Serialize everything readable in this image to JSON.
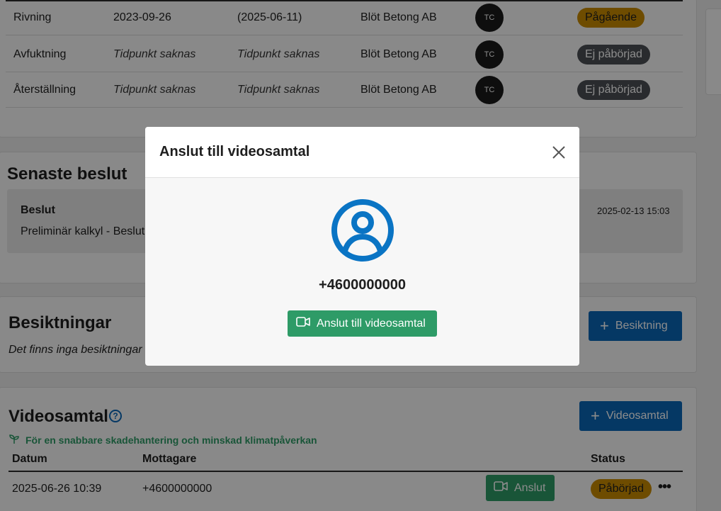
{
  "phases": [
    {
      "name": "Rivning",
      "start": "2023-09-26",
      "end": "(2025-06-11)",
      "company": "Blöt Betong AB",
      "avatar": "TC",
      "status": "Pågående",
      "status_color": "orange"
    },
    {
      "name": "Avfuktning",
      "start": "Tidpunkt saknas",
      "end": "Tidpunkt saknas",
      "company": "Blöt Betong AB",
      "avatar": "TC",
      "status": "Ej påbörjad",
      "status_color": "gray"
    },
    {
      "name": "Återställning",
      "start": "Tidpunkt saknas",
      "end": "Tidpunkt saknas",
      "company": "Blöt Betong AB",
      "avatar": "TC",
      "status": "Ej påbörjad",
      "status_color": "gray"
    }
  ],
  "decisions": {
    "title": "Senaste beslut",
    "label": "Beslut",
    "text": "Preliminär kalkyl - Beslut",
    "timestamp": "2025-02-13 15:03"
  },
  "inspections": {
    "title": "Besiktningar",
    "empty_text": "Det finns inga besiktningar",
    "add_button": "Besiktning"
  },
  "video_calls": {
    "title": "Videosamtal",
    "tagline": "För en snabbare skadehantering och minskad klimatpåverkan",
    "add_button": "Videosamtal",
    "columns": {
      "date": "Datum",
      "recipient": "Mottagare",
      "status": "Status"
    },
    "rows": [
      {
        "date": "2025-06-26 10:39",
        "recipient": "+4600000000",
        "join_label": "Anslut",
        "status": "Påbörjad"
      }
    ]
  },
  "modal": {
    "title": "Anslut till videosamtal",
    "phone": "+4600000000",
    "join_button": "Anslut till videosamtal"
  },
  "colors": {
    "primary_blue": "#0a66b7",
    "green": "#2e9b67",
    "status_orange": "#c98a00",
    "status_gray": "#4b4f54",
    "user_icon_blue": "#0a74c4"
  }
}
